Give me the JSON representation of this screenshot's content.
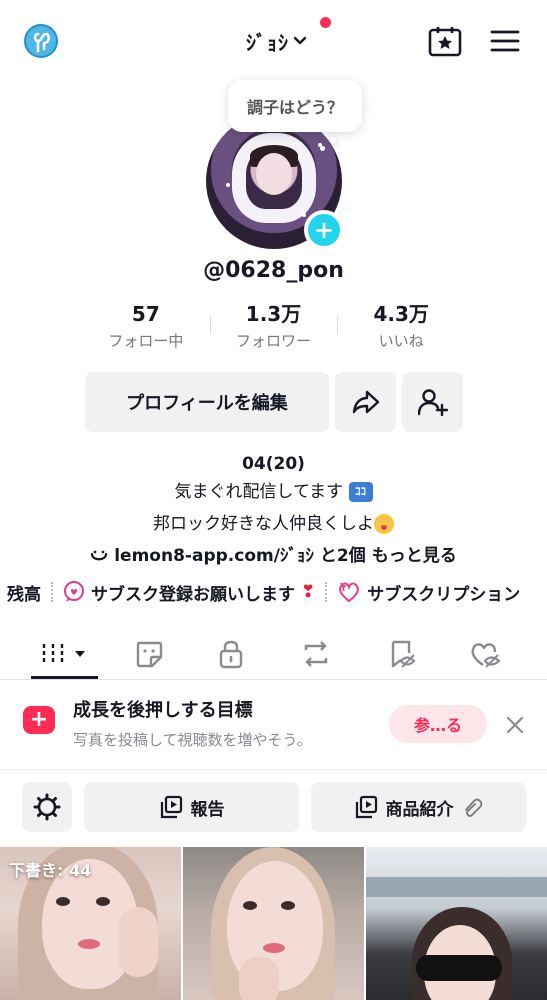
{
  "header": {
    "account_name": "ｼﾞｮｼ",
    "notification_color": "#fe2c55",
    "icons": [
      "app-logo-icon",
      "chevron-down-icon",
      "calendar-star-icon",
      "hamburger-menu-icon"
    ]
  },
  "profile": {
    "bubble_text": "調子はどう？",
    "username": "@0628_pon",
    "add_avatar_symbol": "+",
    "stats": [
      {
        "value": "57",
        "label": "フォロー中"
      },
      {
        "value": "1.3万",
        "label": "フォロワー"
      },
      {
        "value": "4.3万",
        "label": "いいね"
      }
    ],
    "edit_button": "プロフィールを編集"
  },
  "bio": {
    "line1": "04(20)",
    "line2": "気まぐれ配信してます",
    "line2_badge": "ｺｺ",
    "line3": "邦ロック好きな人仲良くしよ",
    "link_text": "lemon8-app.com/ｼﾞｮｼ",
    "link_more": "と2個",
    "see_more": "もっと見る"
  },
  "sub_strip": {
    "item0": "残高",
    "item1": "サブスク登録お願いします",
    "item1_heart": "❣",
    "item2": "サブスクリプション"
  },
  "tabs": [
    "videos-grid",
    "favorites",
    "private",
    "reposts",
    "hidden",
    "liked"
  ],
  "growth": {
    "title": "成長を後押しする目標",
    "subtitle": "写真を投稿して視聴数を増やそう。",
    "button": "参…る",
    "icon_symbol": "+",
    "accent": "#fe2c55"
  },
  "tools": {
    "report": "報告",
    "products": "商品紹介"
  },
  "grid": {
    "draft_label": "下書き: 44"
  }
}
